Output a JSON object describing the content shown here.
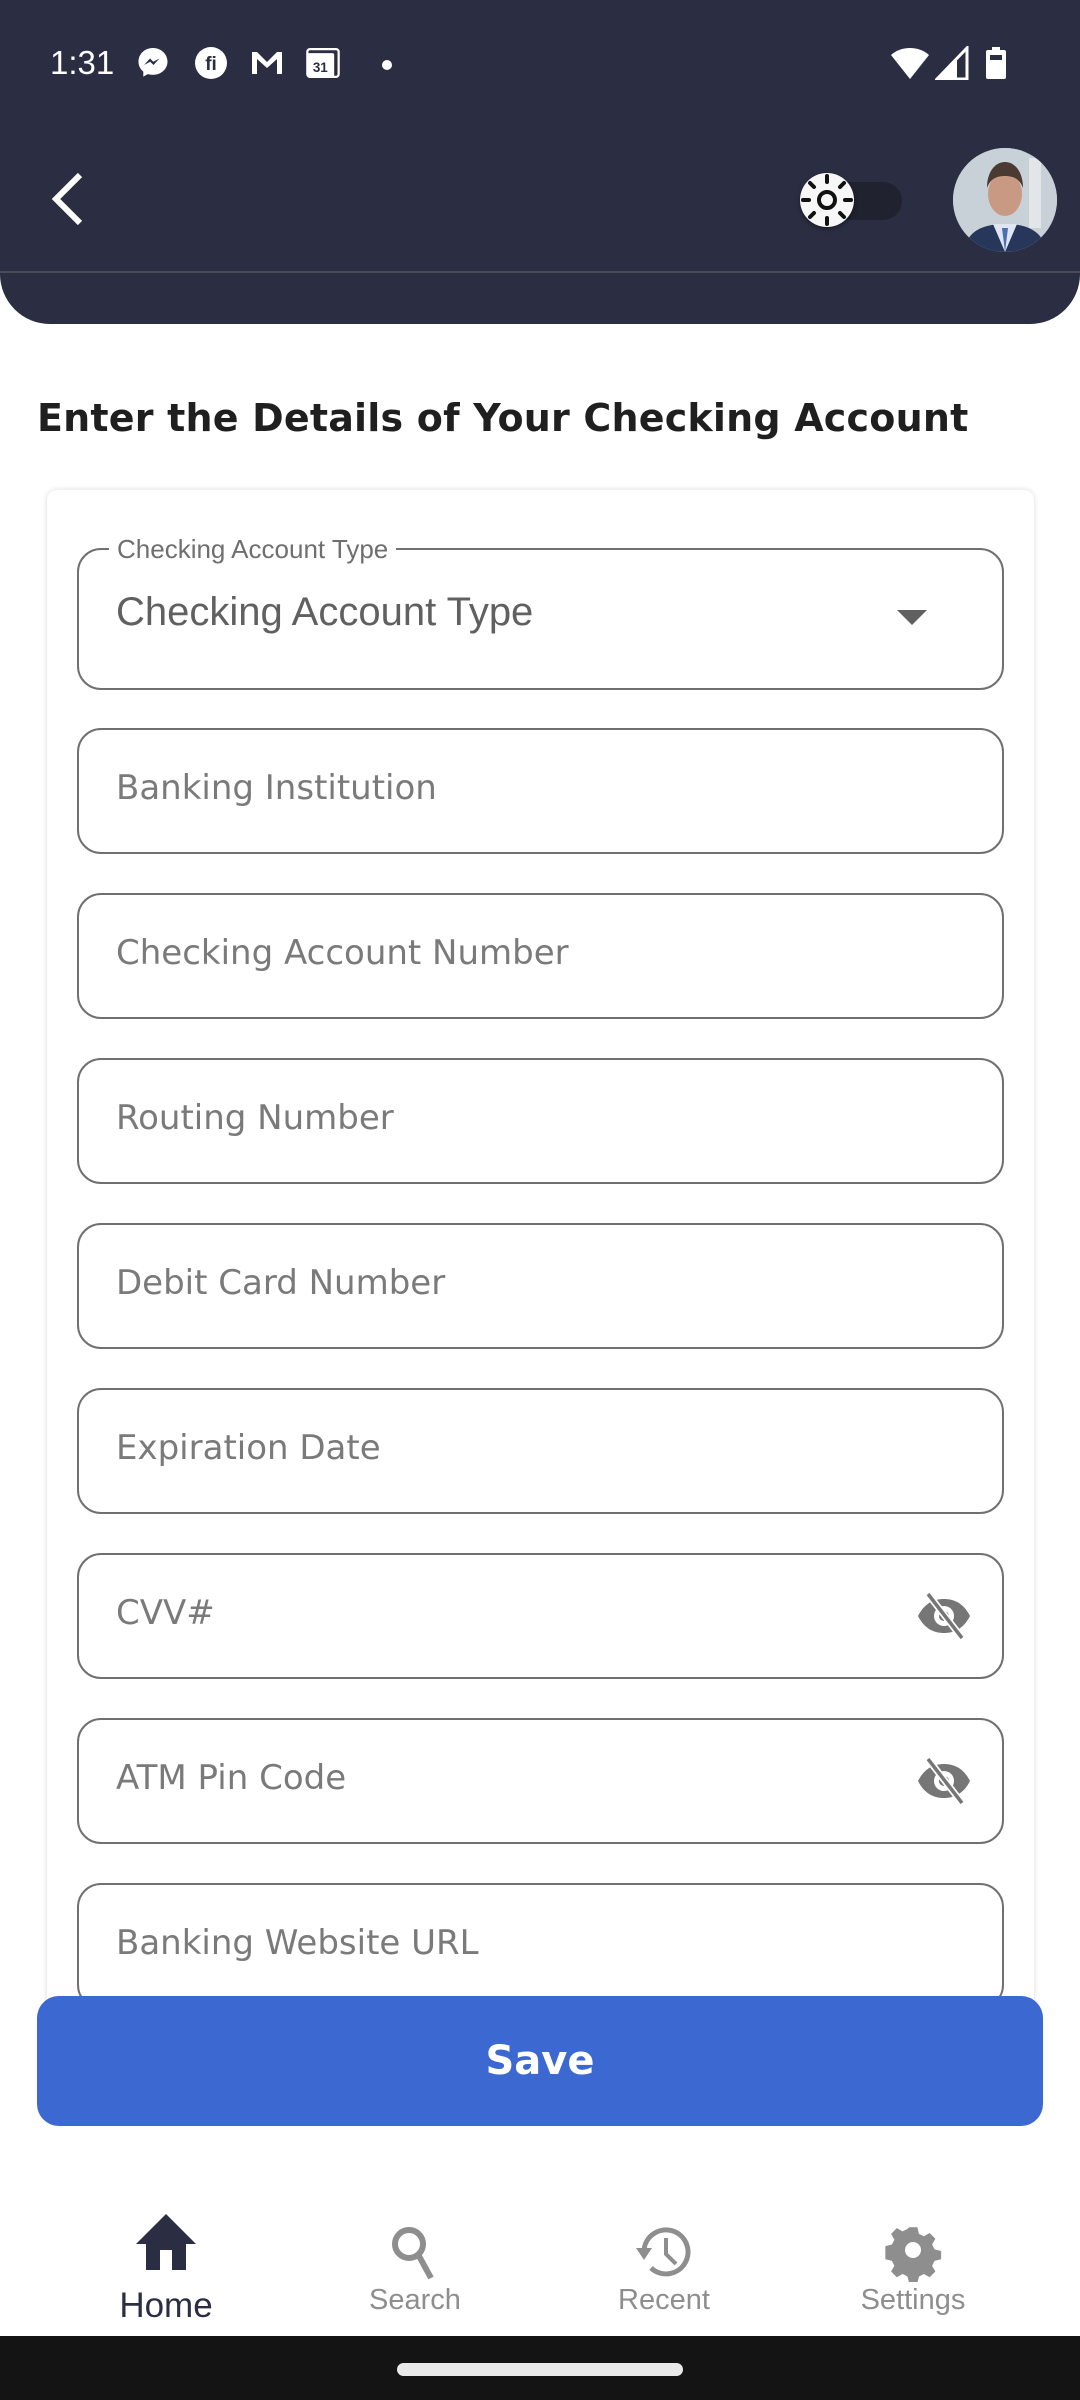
{
  "status_bar": {
    "time": "1:31",
    "notification_icons": [
      "messenger-icon",
      "fi-app-icon",
      "gmail-icon",
      "calendar-icon",
      "more-notifications-dot"
    ],
    "calendar_day": "31",
    "system_icons": [
      "wifi-icon",
      "cell-signal-icon",
      "battery-icon"
    ]
  },
  "header": {
    "back_icon": "chevron-left-icon",
    "theme_toggle": {
      "icon": "sun-icon",
      "state": "light"
    },
    "avatar": "user-avatar"
  },
  "page": {
    "title": "Enter the Details of Your Checking Account"
  },
  "form": {
    "account_type": {
      "legend": "Checking Account Type",
      "value": "Checking Account Type"
    },
    "fields": [
      {
        "placeholder": "Banking Institution",
        "value": ""
      },
      {
        "placeholder": "Checking Account Number",
        "value": ""
      },
      {
        "placeholder": "Routing Number",
        "value": ""
      },
      {
        "placeholder": "Debit Card Number",
        "value": ""
      },
      {
        "placeholder": "Expiration Date",
        "value": ""
      },
      {
        "placeholder": "CVV#",
        "value": "",
        "toggle_icon": "eye-off-icon"
      },
      {
        "placeholder": "ATM Pin Code",
        "value": "",
        "toggle_icon": "eye-off-icon"
      },
      {
        "placeholder": "Banking Website URL",
        "value": ""
      }
    ],
    "save_label": "Save"
  },
  "bottom_nav": {
    "items": [
      {
        "label": "Home",
        "icon": "home-icon",
        "active": true
      },
      {
        "label": "Search",
        "icon": "search-icon",
        "active": false
      },
      {
        "label": "Recent",
        "icon": "history-icon",
        "active": false
      },
      {
        "label": "Settings",
        "icon": "gear-icon",
        "active": false
      }
    ]
  },
  "colors": {
    "header_bg": "#2b2e42",
    "primary": "#3b68d1",
    "active_nav": "#2b2e42",
    "inactive_nav": "#8e8e8e",
    "field_border": "#707070"
  }
}
